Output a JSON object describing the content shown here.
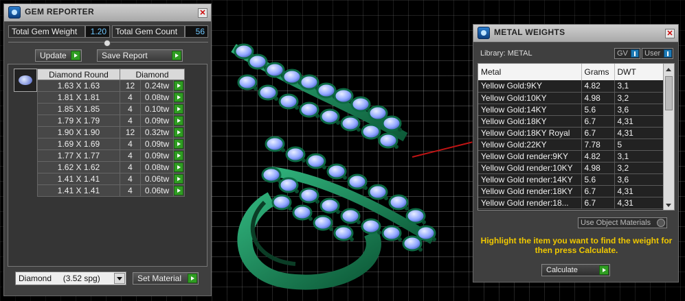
{
  "gem_reporter": {
    "title": "GEM REPORTER",
    "total_weight_label": "Total Gem Weight",
    "total_weight_value": "1.20",
    "total_count_label": "Total Gem Count",
    "total_count_value": "56",
    "update_label": "Update",
    "save_report_label": "Save Report",
    "columns": [
      "Diamond Round",
      "Diamond"
    ],
    "rows": [
      {
        "size": "1.63 X 1.63",
        "count": "12",
        "weight": "0.24tw"
      },
      {
        "size": "1.81 X 1.81",
        "count": "4",
        "weight": "0.08tw"
      },
      {
        "size": "1.85 X 1.85",
        "count": "4",
        "weight": "0.10tw"
      },
      {
        "size": "1.79 X 1.79",
        "count": "4",
        "weight": "0.09tw"
      },
      {
        "size": "1.90 X 1.90",
        "count": "12",
        "weight": "0.32tw"
      },
      {
        "size": "1.69 X 1.69",
        "count": "4",
        "weight": "0.09tw"
      },
      {
        "size": "1.77 X 1.77",
        "count": "4",
        "weight": "0.09tw"
      },
      {
        "size": "1.62 X 1.62",
        "count": "4",
        "weight": "0.08tw"
      },
      {
        "size": "1.41 X 1.41",
        "count": "4",
        "weight": "0.06tw"
      },
      {
        "size": "1.41 X 1.41",
        "count": "4",
        "weight": "0.06tw"
      }
    ],
    "material_select": "Diamond     (3.52 spg)",
    "set_material_label": "Set Material"
  },
  "metal_weights": {
    "title": "METAL WEIGHTS",
    "library_label": "Library: METAL",
    "gv_label": "GV",
    "user_label": "User",
    "columns": [
      "Metal",
      "Grams",
      "DWT"
    ],
    "rows": [
      {
        "metal": "Yellow Gold:9KY",
        "grams": "4.82",
        "dwt": "3,1"
      },
      {
        "metal": "Yellow Gold:10KY",
        "grams": "4.98",
        "dwt": "3,2"
      },
      {
        "metal": "Yellow Gold:14KY",
        "grams": "5.6",
        "dwt": "3,6"
      },
      {
        "metal": "Yellow Gold:18KY",
        "grams": "6.7",
        "dwt": "4,31"
      },
      {
        "metal": "Yellow Gold:18KY Royal",
        "grams": "6.7",
        "dwt": "4,31"
      },
      {
        "metal": "Yellow Gold:22KY",
        "grams": "7.78",
        "dwt": "5"
      },
      {
        "metal": "Yellow Gold render:9KY",
        "grams": "4.82",
        "dwt": "3,1"
      },
      {
        "metal": "Yellow Gold render:10KY",
        "grams": "4.98",
        "dwt": "3,2"
      },
      {
        "metal": "Yellow Gold render:14KY",
        "grams": "5.6",
        "dwt": "3,6"
      },
      {
        "metal": "Yellow Gold render:18KY",
        "grams": "6.7",
        "dwt": "4,31"
      },
      {
        "metal": "Yellow Gold render:18...",
        "grams": "6.7",
        "dwt": "4,31"
      }
    ],
    "use_object_materials_label": "Use Object Materials",
    "hint": "Highlight the item you want to find the weight for then press Calculate.",
    "calculate_label": "Calculate"
  },
  "colors": {
    "metal_green": "#1f8f5c",
    "gem_blue": "#7f9cff",
    "hint_yellow": "#f0c800",
    "go_green": "#2f9d22"
  }
}
